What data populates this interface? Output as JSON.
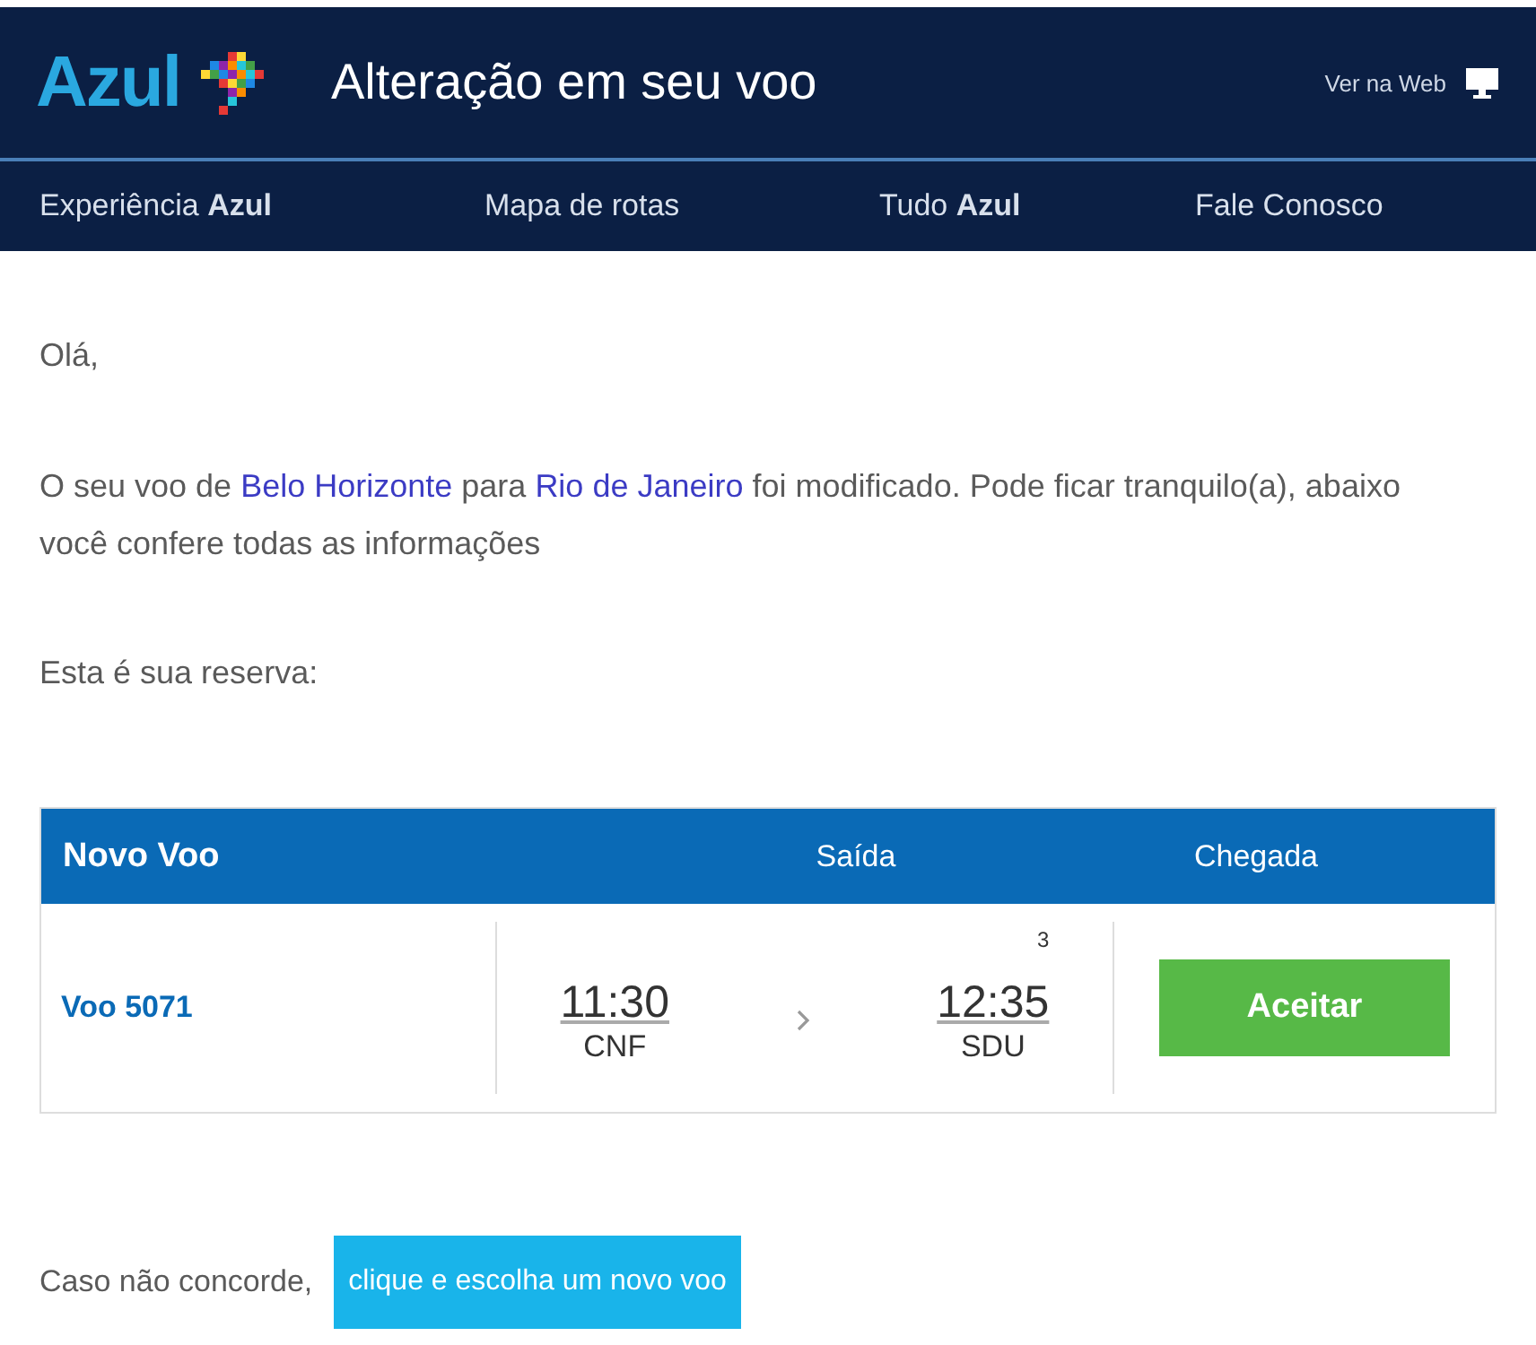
{
  "header": {
    "logo": "Azul",
    "title": "Alteração em seu voo",
    "web_link": "Ver na Web"
  },
  "nav": [
    "Experiência **Azul**",
    "Mapa de rotas",
    "Tudo **Azul**",
    "Fale Conosco"
  ],
  "greeting": "Olá,",
  "message": {
    "before": "O seu voo de ",
    "origin": "Belo Horizonte",
    "middle": " para ",
    "destination": "Rio de Janeiro",
    "after": " foi modificado. Pode ficar tranquilo(a), abaixo você confere todas as informações"
  },
  "reservation_label": "Esta é sua reserva:",
  "flight_table": {
    "title": "Novo Voo",
    "columns": [
      "Saída",
      "Chegada"
    ],
    "flight": "Voo 5071",
    "departure": {
      "time": "11:30",
      "airport": "CNF"
    },
    "arrival": {
      "time": "12:35",
      "airport": "SDU",
      "note": "3"
    },
    "button": "Aceitar"
  },
  "footer": {
    "text": "Caso não concorde,",
    "button": "clique e escolha um novo voo"
  }
}
